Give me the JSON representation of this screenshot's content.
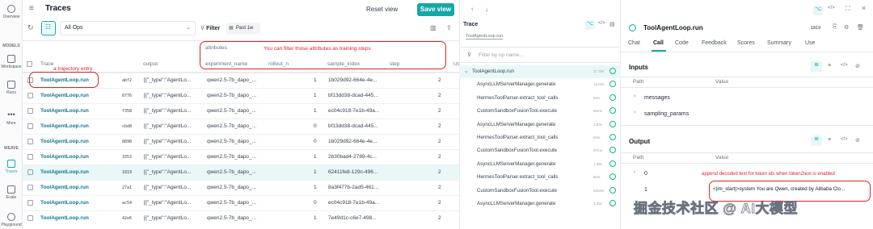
{
  "nav": {
    "items": [
      {
        "label": "Overview",
        "icon": "overview-icon"
      },
      {
        "label": "Workspace",
        "icon": "workspace-icon"
      },
      {
        "label": "Runs",
        "icon": "runs-icon"
      },
      {
        "label": "More",
        "icon": "more-icon"
      },
      {
        "label": "Traces",
        "icon": "traces-icon"
      },
      {
        "label": "Evals",
        "icon": "evals-icon"
      },
      {
        "label": "Playground",
        "icon": "playground-icon"
      }
    ],
    "models_label": "MODELS",
    "weave_label": "WEAVE"
  },
  "traces": {
    "title": "Traces",
    "reset_label": "Reset view",
    "save_label": "Save view",
    "ops_select": "All Ops",
    "filter_label": "Filter",
    "date_chip": "Past 1w",
    "columns": {
      "trace": "Trace",
      "output": "output",
      "attributes": "attributes",
      "experiment": "experiment_name",
      "rollout": "rollout_n",
      "sample": "sample_index",
      "step": "step",
      "us": "Us"
    },
    "rows": [
      {
        "op": "ToolAgentLoop.run",
        "id": "abf2",
        "output": "[{\"_type\":\"AgentLo...",
        "exp": "qwen2.5-7b_dapo_...",
        "rollout": "1",
        "sample": "1b029d92-664e-4e...",
        "step": "2"
      },
      {
        "op": "ToolAgentLoop.run",
        "id": "6776",
        "output": "[{\"_type\":\"AgentLo...",
        "exp": "qwen2.5-7b_dapo_...",
        "rollout": "1",
        "sample": "bf13dd38-dcad-445...",
        "step": "2"
      },
      {
        "op": "ToolAgentLoop.run",
        "id": "f358",
        "output": "[{\"_type\":\"AgentLo...",
        "exp": "qwen2.5-7b_dapo_...",
        "rollout": "1",
        "sample": "ec04c918-7e1b-49a...",
        "step": "2"
      },
      {
        "op": "ToolAgentLoop.run",
        "id": "cbd8",
        "output": "[{\"_type\":\"AgentLo...",
        "exp": "qwen2.5-7b_dapo_...",
        "rollout": "0",
        "sample": "bf13dd38-dcad-445...",
        "step": "2"
      },
      {
        "op": "ToolAgentLoop.run",
        "id": "8898",
        "output": "[{\"_type\":\"AgentLo...",
        "exp": "qwen2.5-7b_dapo_...",
        "rollout": "0",
        "sample": "1b029d92-664e-4e...",
        "step": "2"
      },
      {
        "op": "ToolAgentLoop.run",
        "id": "3353",
        "output": "[{\"_type\":\"AgentLo...",
        "exp": "qwen2.5-7b_dapo_...",
        "rollout": "1",
        "sample": "2b30bad4-2789-4c...",
        "step": "2"
      },
      {
        "op": "ToolAgentLoop.run",
        "id": "1819",
        "output": "[{\"_type\":\"AgentLo...",
        "exp": "qwen2.5-7b_dapo_...",
        "rollout": "1",
        "sample": "62411fe8-129c-496...",
        "step": "2"
      },
      {
        "op": "ToolAgentLoop.run",
        "id": "27a1",
        "output": "[{\"_type\":\"AgentLo...",
        "exp": "qwen2.5-7b_dapo_...",
        "rollout": "1",
        "sample": "8a3f477b-2ad5-461...",
        "step": "2"
      },
      {
        "op": "ToolAgentLoop.run",
        "id": "ac54",
        "output": "[{\"_type\":\"AgentLo...",
        "exp": "qwen2.5-7b_dapo_...",
        "rollout": "0",
        "sample": "ec04c918-7e1b-49a...",
        "step": "2"
      },
      {
        "op": "ToolAgentLoop.run",
        "id": "42e6",
        "output": "[{\"_type\":\"AgentLo...",
        "exp": "qwen2.5-7b_dapo_...",
        "rollout": "1",
        "sample": "7e49d1c-c6e7-498...",
        "step": "2"
      }
    ],
    "annotations": {
      "trajectory": "a trajectory entry",
      "filter_attrs": "You can filter those attributes as training steps"
    }
  },
  "tree": {
    "title": "Trace",
    "chip": "ToolAgentLoop.run",
    "filter_placeholder": "Filter by op name...",
    "nodes": [
      {
        "name": "ToolAgentLoop.run",
        "time": "17.75s",
        "root": true
      },
      {
        "name": "AsyncLLMServerManager.generate",
        "time": "13.63s"
      },
      {
        "name": "HermesToolParser.extract_tool_calls",
        "time": "6ms"
      },
      {
        "name": "CustomSandboxFusionTool.execute",
        "time": "88ms"
      },
      {
        "name": "AsyncLLMServerManager.generate",
        "time": "1.53s"
      },
      {
        "name": "HermesToolParser.extract_tool_calls",
        "time": "6ms"
      },
      {
        "name": "CustomSandboxFusionTool.execute",
        "time": "87ms"
      },
      {
        "name": "AsyncLLMServerManager.generate",
        "time": "1.35s"
      },
      {
        "name": "HermesToolParser.extract_tool_calls",
        "time": "6ms"
      },
      {
        "name": "CustomSandboxFusionTool.execute",
        "time": "530ms"
      },
      {
        "name": "AsyncLLMServerManager.generate",
        "time": "1.25s"
      }
    ]
  },
  "detail": {
    "title": "ToolAgentLoop.run",
    "id": "1819",
    "tabs": [
      "Chat",
      "Call",
      "Code",
      "Feedback",
      "Scores",
      "Summary",
      "Use"
    ],
    "active_tab": "Call",
    "inputs_title": "Inputs",
    "path_label": "Path",
    "value_label": "Value",
    "input_rows": [
      "messages",
      "sampling_params"
    ],
    "output_title": "Output",
    "output_rows": [
      {
        "path": "0",
        "value": ""
      },
      {
        "path": "1",
        "value": "<|im_start|>system You are Qwen, created by Alibaba Clo..."
      }
    ],
    "annotation": "append decoded text for token ids when token2text is enabled",
    "watermark": "掘金技术社区 @ AI大模型"
  },
  "colors": {
    "accent": "#13a8a8",
    "annotation": "#dc2626",
    "link": "#0e7490"
  }
}
